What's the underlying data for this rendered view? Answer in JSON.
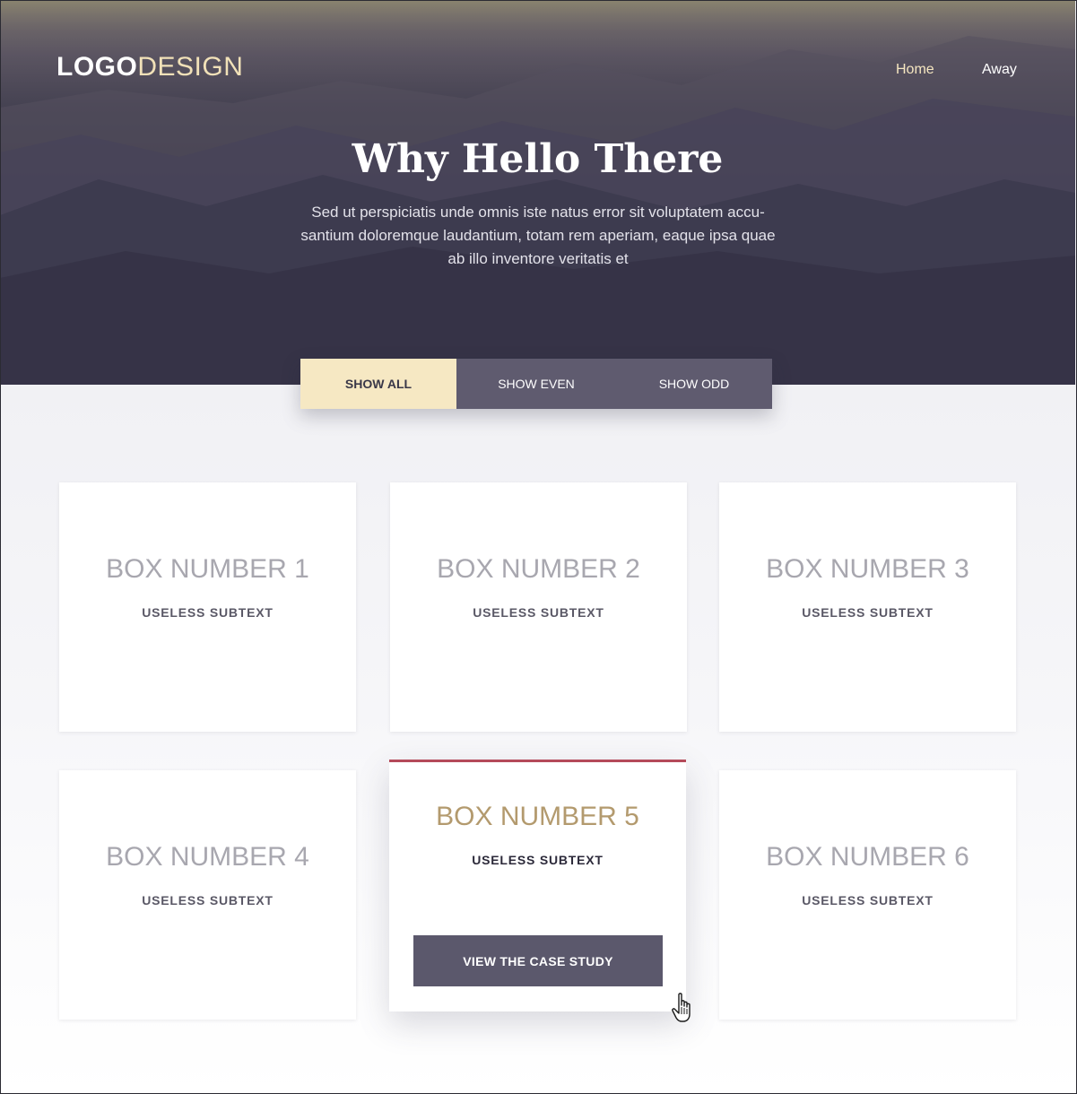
{
  "header": {
    "logo_bold": "LOGO",
    "logo_light": "DESIGN",
    "nav": [
      {
        "label": "Home"
      },
      {
        "label": "Away"
      }
    ]
  },
  "hero": {
    "title": "Why Hello There",
    "lead": "Sed ut perspiciatis unde omnis iste natus error sit voluptatem accu-santium doloremque laudantium, totam rem aperiam, eaque ipsa quae ab illo inventore veritatis et"
  },
  "filter_tabs": [
    {
      "label": "SHOW ALL",
      "active": true
    },
    {
      "label": "SHOW EVEN",
      "active": false
    },
    {
      "label": "SHOW ODD",
      "active": false
    }
  ],
  "cards": [
    {
      "title": "BOX NUMBER 1",
      "subtitle": "USELESS SUBTEXT"
    },
    {
      "title": "BOX NUMBER 2",
      "subtitle": "USELESS SUBTEXT"
    },
    {
      "title": "BOX NUMBER 3",
      "subtitle": "USELESS SUBTEXT"
    },
    {
      "title": "BOX NUMBER 4",
      "subtitle": "USELESS SUBTEXT"
    },
    {
      "title": "BOX NUMBER 5",
      "subtitle": "USELESS SUBTEXT",
      "highlighted": true,
      "button": "VIEW THE CASE STUDY"
    },
    {
      "title": "BOX NUMBER 6",
      "subtitle": "USELESS SUBTEXT"
    }
  ],
  "colors": {
    "accent_cream": "#f6e8c3",
    "tab_bg": "#5f5b6f",
    "highlight_border": "#b54a5a",
    "highlight_title": "#b39a6e",
    "button_bg": "#5b586c"
  }
}
